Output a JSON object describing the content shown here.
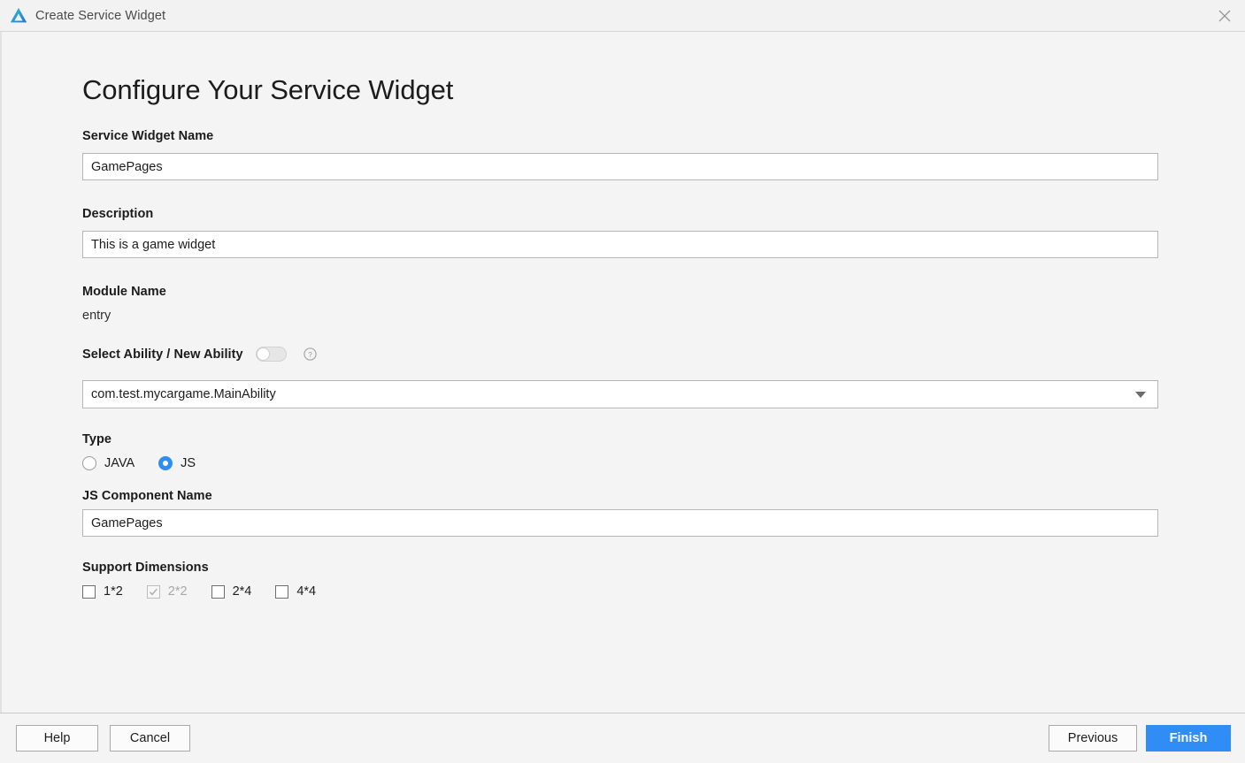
{
  "window": {
    "title": "Create Service Widget",
    "logo_icon": "deveco-logo-icon",
    "close_icon": "close-icon"
  },
  "page": {
    "heading": "Configure Your Service Widget"
  },
  "form": {
    "widget_name": {
      "label": "Service Widget Name",
      "value": "GamePages",
      "placeholder": ""
    },
    "description": {
      "label": "Description",
      "value": "This is a game widget",
      "placeholder": ""
    },
    "module_name": {
      "label": "Module Name",
      "value": "entry"
    },
    "select_ability": {
      "label": "Select Ability / New Ability",
      "toggle_state": "off",
      "help_icon": "question-mark-icon",
      "dropdown_value": "com.test.mycargame.MainAbility",
      "dropdown_icon": "chevron-down-icon"
    },
    "type": {
      "label": "Type",
      "options": [
        {
          "label": "JAVA",
          "selected": false
        },
        {
          "label": "JS",
          "selected": true
        }
      ]
    },
    "js_component_name": {
      "label": "JS Component Name",
      "value": "GamePages",
      "placeholder": ""
    },
    "support_dimensions": {
      "label": "Support Dimensions",
      "options": [
        {
          "label": "1*2",
          "checked": false,
          "disabled": false
        },
        {
          "label": "2*2",
          "checked": true,
          "disabled": true
        },
        {
          "label": "2*4",
          "checked": false,
          "disabled": false
        },
        {
          "label": "4*4",
          "checked": false,
          "disabled": false
        }
      ]
    }
  },
  "footer": {
    "help": "Help",
    "cancel": "Cancel",
    "previous": "Previous",
    "finish": "Finish"
  },
  "colors": {
    "accent": "#2f8df5",
    "background": "#f4f4f4",
    "titlebar": "#f2f2f2",
    "input_border": "#b6b6b6",
    "text": "#1d1d1d",
    "disabled_text": "#a8a8a8"
  }
}
